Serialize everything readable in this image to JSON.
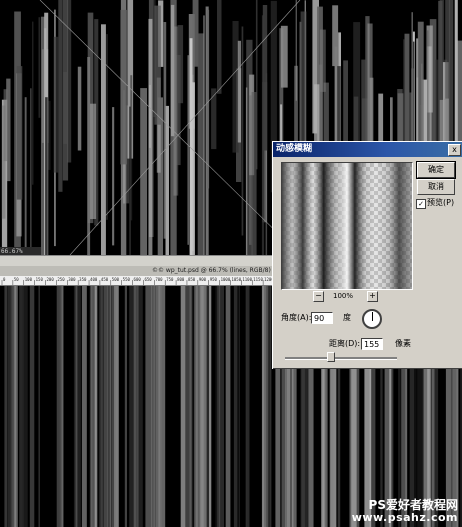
{
  "canvas_top": {
    "zoom_status": "66.67% [100.0%]"
  },
  "document": {
    "title": "©© wp_tut.psd @ 66.7% (lines, RGB/8)",
    "ruler_labels": [
      "0",
      "50",
      "100",
      "150",
      "200",
      "250",
      "300",
      "350",
      "400",
      "450",
      "500",
      "550",
      "600",
      "650",
      "700",
      "750",
      "800",
      "850",
      "900",
      "950",
      "1000",
      "1050",
      "1100",
      "1150",
      "1200"
    ]
  },
  "dialog": {
    "title": "动感模糊",
    "close_glyph": "x",
    "ok_label": "确定",
    "cancel_label": "取消",
    "preview_label": "预览(P)",
    "preview_checked": true,
    "zoom_out_glyph": "−",
    "zoom_in_glyph": "+",
    "zoom_level": "100%",
    "angle_label": "角度(A):",
    "angle_value": "90",
    "angle_unit": "度",
    "distance_label": "距离(D):",
    "distance_value": "155",
    "distance_unit": "像素",
    "distance_slider_fraction": 0.4
  },
  "watermark": {
    "line1": "PS爱好者教程网",
    "line2": "www.psahz.com"
  },
  "colors": {
    "dialog_bg": "#d4d0c8",
    "title_bar": "#0a246a",
    "canvas_bg": "#000000"
  }
}
